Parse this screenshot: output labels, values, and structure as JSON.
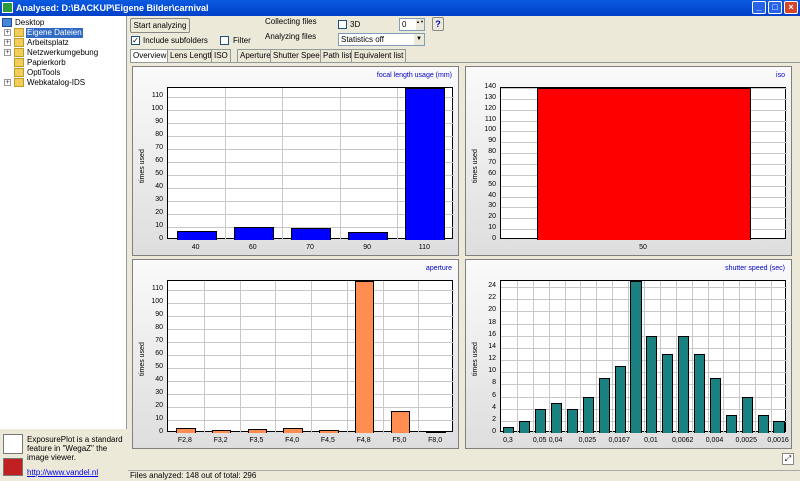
{
  "window": {
    "title": "Analysed: D:\\BACKUP\\Eigene Bilder\\carnival",
    "min": "_",
    "max": "□",
    "close": "×"
  },
  "tree": {
    "items": [
      {
        "label": "Desktop",
        "expander": ""
      },
      {
        "label": "Eigene Dateien",
        "expander": "+"
      },
      {
        "label": "Arbeitsplatz",
        "expander": "+"
      },
      {
        "label": "Netzwerkumgebung",
        "expander": "+"
      },
      {
        "label": "Papierkorb",
        "expander": ""
      },
      {
        "label": "OptiTools",
        "expander": ""
      },
      {
        "label": "Webkatalog-IDS",
        "expander": "+"
      }
    ]
  },
  "info": {
    "text": "ExposurePlot is a standard feature in \"WegaZ\" the image viewer.",
    "link": "http://www.vandel.nl"
  },
  "toolbar": {
    "start_label": "Start analyzing",
    "include_label": "Include subfolders",
    "include_checked": "✓",
    "filter_label": "Filter",
    "collecting": "Collecting files",
    "analyzing": "Analyzing files",
    "threed_label": "3D",
    "spin_value": "0",
    "spin_arrows": "▲▼",
    "stats_value": "Statistics off",
    "stats_arrow": "▼",
    "help": "?"
  },
  "tabs": [
    "Overview",
    "Lens Length",
    "ISO",
    "Aperture",
    "Shutter Speed",
    "Path list",
    "Equivalent list"
  ],
  "status": "Files analyzed: 148 out of total: 296",
  "colors": {
    "focal": "#0000ff",
    "iso": "#ff0000",
    "aperture": "#ff8c50",
    "shutter": "#1a8080"
  },
  "chart_data": [
    {
      "type": "bar",
      "title": "focal length usage (mm)",
      "ylabel": "times used",
      "categories": [
        "40",
        "60",
        "70",
        "90",
        "110"
      ],
      "values": [
        7,
        10,
        9,
        6,
        117
      ],
      "ylim": [
        0,
        117
      ],
      "yticks": [
        0,
        10,
        20,
        30,
        40,
        50,
        60,
        70,
        80,
        90,
        100,
        110
      ],
      "grid": true
    },
    {
      "type": "bar",
      "title": "iso",
      "ylabel": "times used",
      "categories": [
        "50"
      ],
      "values": [
        140
      ],
      "ylim": [
        0,
        140
      ],
      "yticks": [
        0,
        10,
        20,
        30,
        40,
        50,
        60,
        70,
        80,
        90,
        100,
        110,
        120,
        130,
        140
      ],
      "grid": true
    },
    {
      "type": "bar",
      "title": "aperture",
      "ylabel": "times used",
      "categories": [
        "F2,8",
        "F3,2",
        "F3,5",
        "F4,0",
        "F4,5",
        "F4,8",
        "F5,0",
        "F8,0"
      ],
      "values": [
        4,
        2,
        3,
        4,
        2,
        117,
        17,
        1
      ],
      "ylim": [
        0,
        117
      ],
      "yticks": [
        0,
        10,
        20,
        30,
        40,
        50,
        60,
        70,
        80,
        90,
        100,
        110
      ],
      "grid": true
    },
    {
      "type": "bar",
      "title": "shutter speed (sec)",
      "ylabel": "times used",
      "categories": [
        "0,3",
        "",
        "0,05",
        "0,04",
        "",
        "0,025",
        "",
        "0,0167",
        "",
        "0,01",
        "",
        "0,0062",
        "",
        "0,004",
        "",
        "0,0025",
        "",
        "0,0016"
      ],
      "values": [
        1,
        2,
        4,
        5,
        4,
        6,
        9,
        11,
        25,
        16,
        13,
        16,
        13,
        9,
        3,
        6,
        3,
        2
      ],
      "ylim": [
        0,
        25
      ],
      "yticks": [
        0,
        2,
        4,
        6,
        8,
        10,
        12,
        14,
        16,
        18,
        20,
        22,
        24
      ],
      "grid": true
    }
  ]
}
